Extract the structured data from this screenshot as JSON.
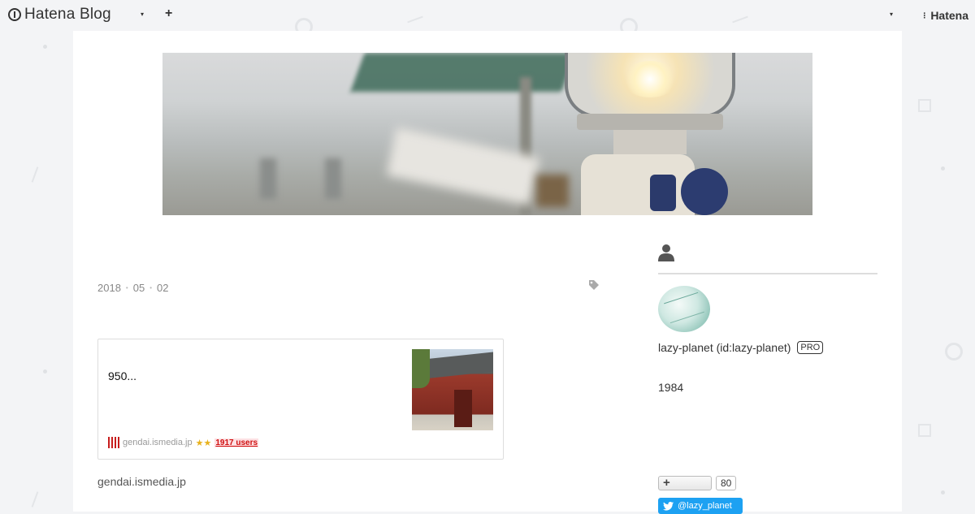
{
  "globalbar": {
    "brand": "Hatena Blog",
    "caret": "▾",
    "plus": "+",
    "hatena_label": "Hatena"
  },
  "entry": {
    "date": {
      "year": "2018",
      "month": "05",
      "day": "02",
      "sep": "•"
    },
    "embed": {
      "title": "950...",
      "domain": "gendai.ismedia.jp",
      "stars": "★★",
      "users": "1917 users"
    },
    "source": "gendai.ismedia.jp"
  },
  "sidebar": {
    "username": "lazy-planet (id:lazy-planet)",
    "pro": "PRO",
    "year": "1984",
    "follow_plus": "+",
    "follow_count": "80",
    "twitter": "@lazy_planet"
  }
}
